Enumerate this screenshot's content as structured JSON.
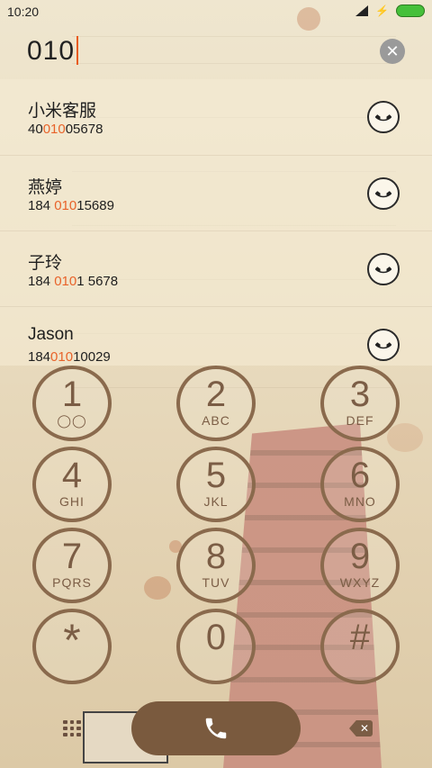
{
  "status_bar": {
    "time": "10:20"
  },
  "search": {
    "query": "010"
  },
  "contacts": [
    {
      "name": "小米客服",
      "number_before": "40",
      "number_match": "010",
      "number_after": "05678"
    },
    {
      "name": "燕婷",
      "number_before": "184 ",
      "number_match": "010",
      "number_after": "15689"
    },
    {
      "name": "子玲",
      "number_before": "184 ",
      "number_match": "010",
      "number_after": "1 5678"
    },
    {
      "name": "Jason",
      "number_before": "184",
      "number_match": "010",
      "number_after": "10029"
    }
  ],
  "keypad": [
    {
      "digit": "1",
      "letters": ""
    },
    {
      "digit": "2",
      "letters": "ABC"
    },
    {
      "digit": "3",
      "letters": "DEF"
    },
    {
      "digit": "4",
      "letters": "GHI"
    },
    {
      "digit": "5",
      "letters": "JKL"
    },
    {
      "digit": "6",
      "letters": "MNO"
    },
    {
      "digit": "7",
      "letters": "PQRS"
    },
    {
      "digit": "8",
      "letters": "TUV"
    },
    {
      "digit": "9",
      "letters": "WXYZ"
    },
    {
      "digit": "*",
      "letters": ""
    },
    {
      "digit": "0",
      "letters": ""
    },
    {
      "digit": "#",
      "letters": ""
    }
  ],
  "icons": {
    "clear": "close-icon",
    "call": "phone-icon",
    "dialpad": "dialpad-icon",
    "backspace": "backspace-icon",
    "voicemail": "voicemail-icon"
  },
  "colors": {
    "match_highlight": "#e8632a",
    "key_ring": "#8a6a4d",
    "call_button": "#7a5a3e"
  }
}
